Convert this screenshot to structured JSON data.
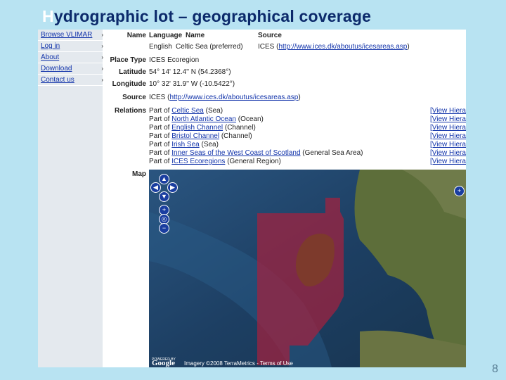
{
  "slide": {
    "title_first": "H",
    "title_rest": "ydrographic lot – geographical coverage",
    "page_number": "8"
  },
  "sidebar": {
    "items": [
      {
        "label": "Browse VLIMAR"
      },
      {
        "label": "Log in"
      },
      {
        "label": "About"
      },
      {
        "label": "Download"
      },
      {
        "label": "Contact us"
      }
    ],
    "arrow": "›"
  },
  "record": {
    "labels": {
      "name": "Name",
      "place_type": "Place Type",
      "latitude": "Latitude",
      "longitude": "Longitude",
      "source": "Source",
      "relations": "Relations",
      "map": "Map"
    },
    "name_table": {
      "headers": {
        "language": "Language",
        "name": "Name",
        "source": "Source"
      },
      "language": "English",
      "name": "Celtic Sea (preferred)",
      "source_text": "ICES (",
      "source_link": "http://www.ices.dk/aboutus/icesareas.asp",
      "source_close": ")"
    },
    "place_type": "ICES Ecoregion",
    "latitude": "54° 14' 12.4'' N (54.2368°)",
    "longitude": "10° 32' 31.9'' W (-10.5422°)",
    "source": {
      "prefix": "ICES (",
      "link": "http://www.ices.dk/aboutus/icesareas.asp",
      "suffix": ")"
    },
    "relations": [
      {
        "part_of": "Part of",
        "name": "Celtic Sea",
        "type": "(Sea)",
        "hierarchy": "[View Hierarchy]"
      },
      {
        "part_of": "Part of",
        "name": "North Atlantic Ocean",
        "type": "(Ocean)",
        "hierarchy": "[View Hierarchy]"
      },
      {
        "part_of": "Part of",
        "name": "English Channel",
        "type": "(Channel)",
        "hierarchy": "[View Hierarchy]"
      },
      {
        "part_of": "Part of",
        "name": "Bristol Channel",
        "type": "(Channel)",
        "hierarchy": "[View Hierarchy]"
      },
      {
        "part_of": "Part of",
        "name": "Irish Sea",
        "type": "(Sea)",
        "hierarchy": "[View Hierarchy]"
      },
      {
        "part_of": "Part of",
        "name": "Inner Seas of the West Coast of Scotland",
        "type": "(General Sea Area)",
        "hierarchy": "[View Hierarchy]"
      },
      {
        "part_of": "Part of",
        "name": "ICES Ecoregions",
        "type": "(General Region)",
        "hierarchy": "[View Hierarchy]"
      }
    ]
  },
  "map": {
    "controls": {
      "pan_up": "▲",
      "pan_left": "◀",
      "pan_right": "▶",
      "pan_down": "▼",
      "zoom_in": "+",
      "zoom_world": "◎",
      "zoom_out": "−",
      "expand": "+"
    },
    "powered_by": "POWERED BY",
    "logo": "Google",
    "copyright": "Imagery ©2008 TerraMetrics - Terms of Use",
    "colors": {
      "sea": "#1e4264",
      "region": "#a3213e",
      "land": "#5d6e3a"
    }
  }
}
